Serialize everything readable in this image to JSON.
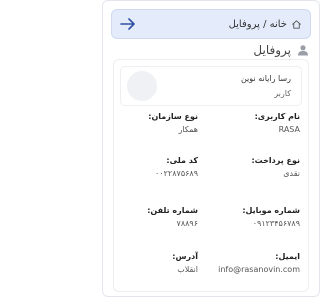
{
  "breadcrumb": {
    "text": "خانه / پروفایل",
    "home_icon": "home-icon",
    "back_icon": "arrow-right-icon"
  },
  "page": {
    "title": "پروفایل",
    "title_icon": "user-icon"
  },
  "profile": {
    "name": "رسا رایانه نوین",
    "role": "کاربر"
  },
  "fields": {
    "username": {
      "label": "نام کاربری:",
      "value": "RASA"
    },
    "org_type": {
      "label": "نوع سازمان:",
      "value": "همکار"
    },
    "national_code": {
      "label": "کد ملی:",
      "value": "۰۰۲۲۸۷۵۶۸۹"
    },
    "payment_type": {
      "label": "نوع پرداخت:",
      "value": "نقدی"
    },
    "mobile": {
      "label": "شماره موبایل:",
      "value": "۰۹۱۲۳۴۵۶۷۸۹"
    },
    "phone": {
      "label": "شماره تلفن:",
      "value": "۷۸۸۹۶"
    },
    "email": {
      "label": "ایمیل:",
      "value": "info@rasanovin.com"
    },
    "address": {
      "label": "آدرس:",
      "value": "انقلاب"
    }
  },
  "colors": {
    "breadcrumb_bg": "#e4ecfb",
    "accent": "#2f5fd0"
  }
}
